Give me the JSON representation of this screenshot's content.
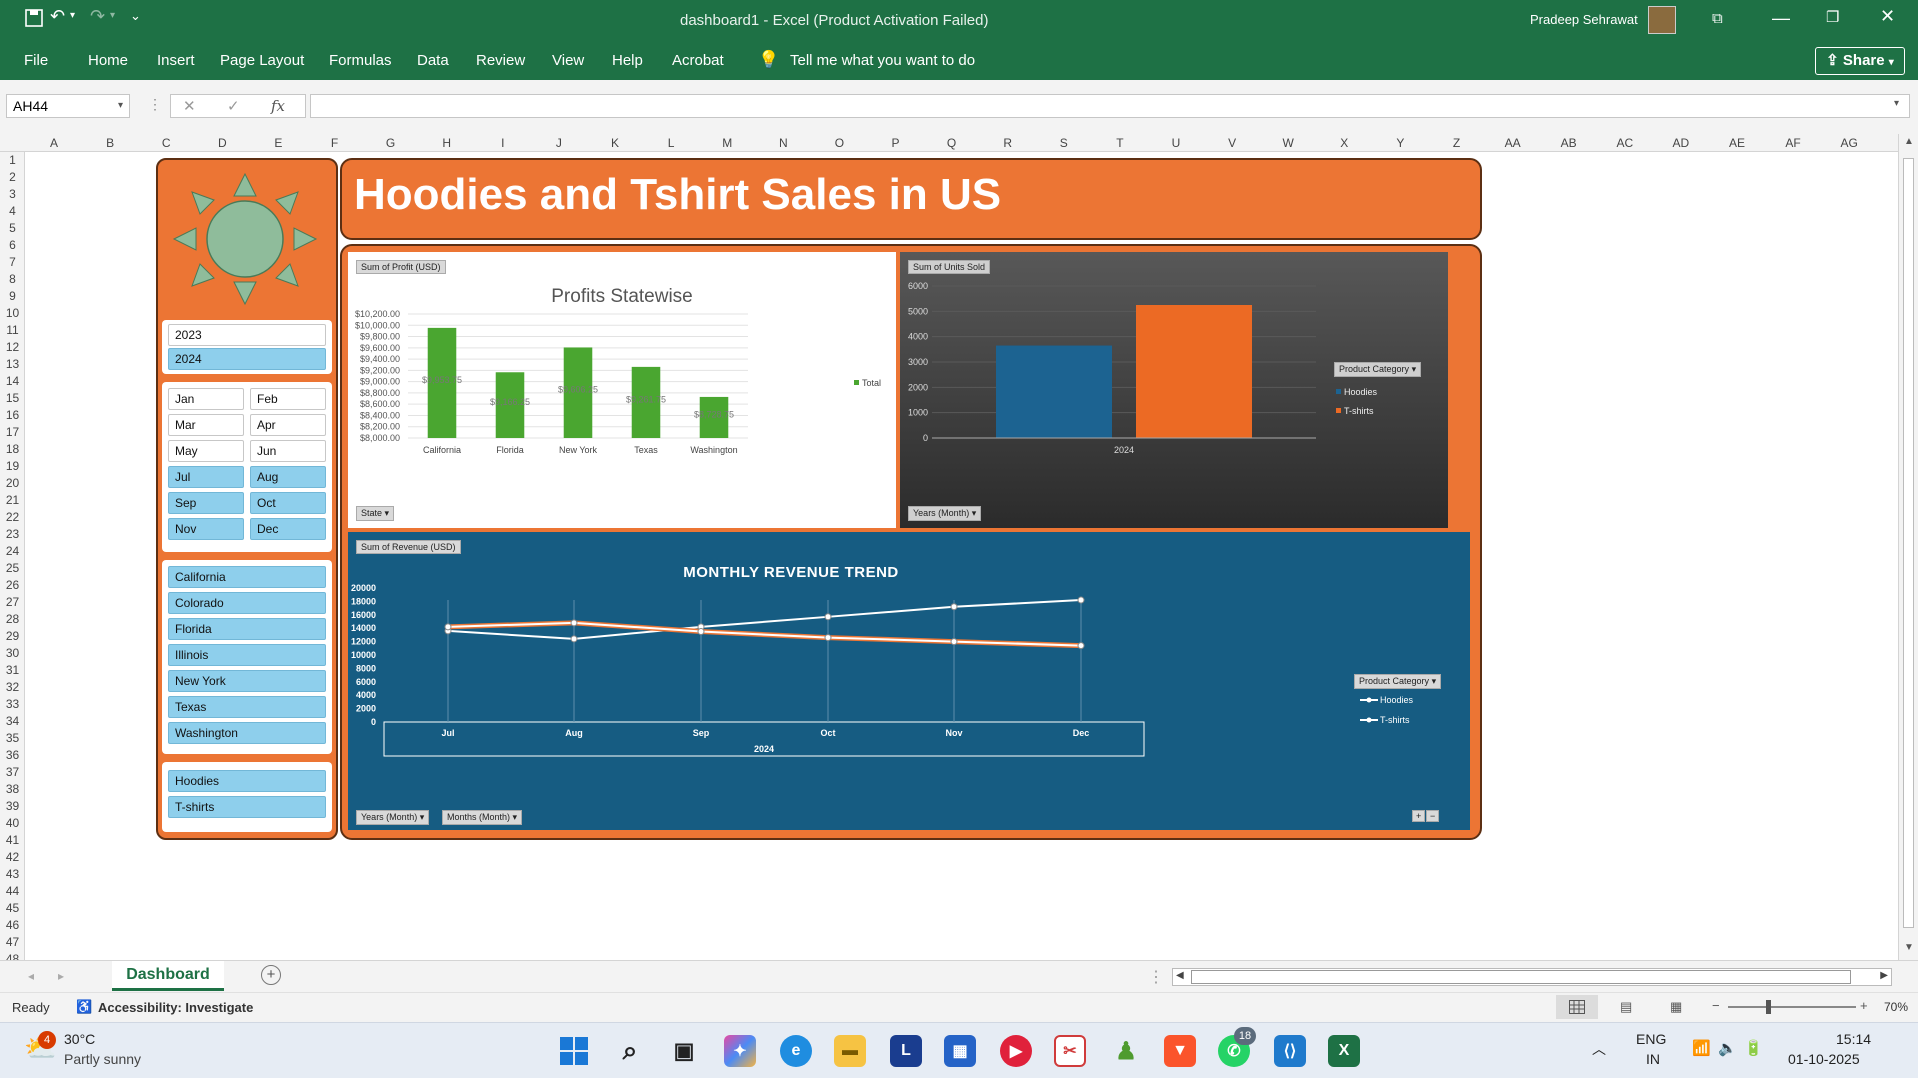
{
  "window": {
    "title": "dashboard1  -  Excel (Product Activation Failed)",
    "user": "Pradeep Sehrawat",
    "share": "Share"
  },
  "ribbon": {
    "tabs": [
      "File",
      "Home",
      "Insert",
      "Page Layout",
      "Formulas",
      "Data",
      "Review",
      "View",
      "Help",
      "Acrobat"
    ],
    "tell_me": "Tell me what you want to do"
  },
  "formula_bar": {
    "name_box": "AH44",
    "fx": "fx",
    "value": ""
  },
  "columns": [
    "A",
    "B",
    "C",
    "D",
    "E",
    "F",
    "G",
    "H",
    "I",
    "J",
    "K",
    "L",
    "M",
    "N",
    "O",
    "P",
    "Q",
    "R",
    "S",
    "T",
    "U",
    "V",
    "W",
    "X",
    "Y",
    "Z",
    "AA",
    "AB",
    "AC",
    "AD",
    "AE",
    "AF",
    "AG"
  ],
  "rows": [
    "1",
    "2",
    "3",
    "4",
    "5",
    "6",
    "7",
    "8",
    "9",
    "10",
    "11",
    "12",
    "13",
    "14",
    "15",
    "16",
    "17",
    "18",
    "19",
    "20",
    "21",
    "22",
    "23",
    "24",
    "25",
    "26",
    "27",
    "28",
    "29",
    "30",
    "31",
    "32",
    "33",
    "34",
    "35",
    "36",
    "37",
    "38",
    "39",
    "40",
    "41",
    "42",
    "43",
    "44",
    "45",
    "46",
    "47",
    "48"
  ],
  "dashboard": {
    "title": "Hoodies and Tshirt Sales in US",
    "slicers": {
      "years": [
        {
          "label": "2023",
          "selected": false
        },
        {
          "label": "2024",
          "selected": true
        }
      ],
      "months": [
        {
          "label": "Jan",
          "selected": false
        },
        {
          "label": "Feb",
          "selected": false
        },
        {
          "label": "Mar",
          "selected": false
        },
        {
          "label": "Apr",
          "selected": false
        },
        {
          "label": "May",
          "selected": false
        },
        {
          "label": "Jun",
          "selected": false
        },
        {
          "label": "Jul",
          "selected": true
        },
        {
          "label": "Aug",
          "selected": true
        },
        {
          "label": "Sep",
          "selected": true
        },
        {
          "label": "Oct",
          "selected": true
        },
        {
          "label": "Nov",
          "selected": true
        },
        {
          "label": "Dec",
          "selected": true
        }
      ],
      "states": [
        {
          "label": "California",
          "selected": true
        },
        {
          "label": "Colorado",
          "selected": true
        },
        {
          "label": "Florida",
          "selected": true
        },
        {
          "label": "Illinois",
          "selected": true
        },
        {
          "label": "New York",
          "selected": true
        },
        {
          "label": "Texas",
          "selected": true
        },
        {
          "label": "Washington",
          "selected": true
        }
      ],
      "products": [
        {
          "label": "Hoodies",
          "selected": true
        },
        {
          "label": "T-shirts",
          "selected": true
        }
      ]
    }
  },
  "chart_data": [
    {
      "type": "bar",
      "title": "Profits Statewise",
      "field_chip": "Sum of Profit (USD)",
      "axis_chip": "State",
      "legend": [
        "Total"
      ],
      "categories": [
        "California",
        "Florida",
        "New York",
        "Texas",
        "Washington"
      ],
      "values": [
        9953.75,
        9166.25,
        9606.25,
        9261.75,
        8728.75
      ],
      "data_labels": [
        "$9,953.75",
        "$9,166.25",
        "$9,606.25",
        "$9,261.75",
        "$8,728.75"
      ],
      "ylim": [
        8000,
        10200
      ],
      "yticks": [
        "$10,200.00",
        "$10,000.00",
        "$9,800.00",
        "$9,600.00",
        "$9,400.00",
        "$9,200.00",
        "$9,000.00",
        "$8,800.00",
        "$8,600.00",
        "$8,400.00",
        "$8,200.00",
        "$8,000.00"
      ],
      "color": "#4aa630"
    },
    {
      "type": "bar",
      "field_chip": "Sum of Units Sold",
      "axis_chip": "Years (Month)",
      "legend_chip": "Product Category",
      "categories": [
        "2024"
      ],
      "series": [
        {
          "name": "Hoodies",
          "values": [
            3650
          ],
          "color": "#1c6391"
        },
        {
          "name": "T-shirts",
          "values": [
            5250
          ],
          "color": "#ec6a24"
        }
      ],
      "ylim": [
        0,
        6000
      ],
      "yticks": [
        "6000",
        "5000",
        "4000",
        "3000",
        "2000",
        "1000",
        "0"
      ]
    },
    {
      "type": "line",
      "title": "MONTHLY REVENUE TREND",
      "field_chip": "Sum of Revenue (USD)",
      "axis_chips": [
        "Years (Month)",
        "Months (Month)"
      ],
      "legend_chip": "Product Category",
      "x": [
        "Jul",
        "Aug",
        "Sep",
        "Oct",
        "Nov",
        "Dec"
      ],
      "x_group": "2024",
      "series": [
        {
          "name": "Hoodies",
          "values": [
            13600,
            12400,
            14200,
            15700,
            17200,
            18200
          ]
        },
        {
          "name": "T-shirts",
          "values": [
            14200,
            14800,
            13500,
            12600,
            12000,
            11400
          ]
        }
      ],
      "ylim": [
        0,
        20000
      ],
      "yticks": [
        "20000",
        "18000",
        "16000",
        "14000",
        "12000",
        "10000",
        "8000",
        "6000",
        "4000",
        "2000",
        "0"
      ]
    }
  ],
  "sheet_tab": "Dashboard",
  "status": {
    "ready": "Ready",
    "accessibility": "Accessibility: Investigate",
    "zoom": "70%"
  },
  "taskbar": {
    "temp": "30°C",
    "weather": "Partly sunny",
    "weather_badge": "4",
    "lang1": "ENG",
    "lang2": "IN",
    "time": "15:14",
    "date": "01-10-2025",
    "whatsapp_badge": "18"
  }
}
